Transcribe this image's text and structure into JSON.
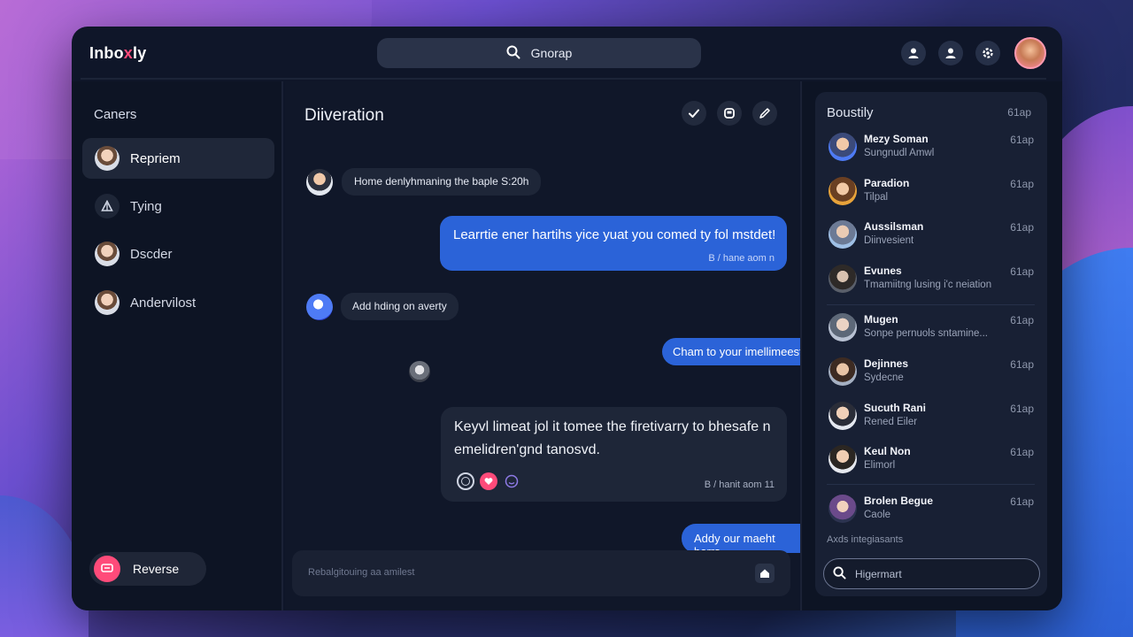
{
  "app": {
    "logo_main": "Inbo",
    "logo_accent": "x",
    "logo_rest": "ly"
  },
  "topbar": {
    "search_text": "Gnorap"
  },
  "left": {
    "heading": "Caners",
    "items": [
      {
        "label": "Repriem",
        "active": true
      },
      {
        "label": "Tying",
        "active": false
      },
      {
        "label": "Dscder",
        "active": false
      },
      {
        "label": "Andervilost",
        "active": false
      }
    ],
    "reverse_label": "Reverse"
  },
  "center": {
    "title": "Diiveration",
    "messages": [
      {
        "text": "Home denlyhmaning the baple S:20h"
      },
      {
        "text": "Learrtie ener hartihs yice yuat you comed ty fol mstdet!",
        "meta": "B / hane aom n"
      },
      {
        "text": "Add hding on averty"
      },
      {
        "text": "Cham to your imellimeest"
      },
      {
        "text": "Keyvl limeat jol it tomee the firetivarry to bhesafe n emelidren'gnd tanosvd.",
        "meta": "B / hanit aom 11"
      },
      {
        "text": "Addy our maeht berrs"
      }
    ],
    "composer_placeholder": "Rebalgitouing aa amilest"
  },
  "right": {
    "heading": "Boustily",
    "heading_time": "61ap",
    "contacts": [
      {
        "name": "Mezy Soman",
        "sub": "Sungnudl Amwl",
        "time": "61ap"
      },
      {
        "name": "Paradion",
        "sub": "Tilpal",
        "time": "61ap"
      },
      {
        "name": "Aussilsman",
        "sub": "Diinvesient",
        "time": "61ap"
      },
      {
        "name": "Evunes",
        "sub": "Tmamiitng lusing i'c neiation",
        "time": "61ap"
      },
      {
        "name": "Mugen",
        "sub": "Sonpe pernuols sntamine...",
        "time": "61ap"
      },
      {
        "name": "Dejinnes",
        "sub": "Sydecne",
        "time": "61ap"
      },
      {
        "name": "Sucuth Rani",
        "sub": "Rened Eiler",
        "time": "61ap"
      },
      {
        "name": "Keul Non",
        "sub": "Elimorl",
        "time": "61ap"
      },
      {
        "name": "Brolen Begue",
        "sub": "Caole",
        "time": "61ap"
      }
    ],
    "footer": "Axds integiasants",
    "search_text": "Higermart"
  },
  "colors": {
    "accent": "#ff4b7a",
    "bubble_blue": "#2b63d8",
    "panel": "#0f1629"
  }
}
